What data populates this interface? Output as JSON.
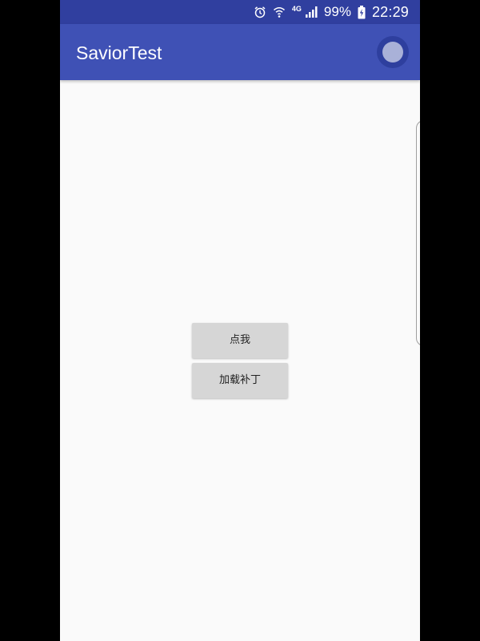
{
  "status_bar": {
    "network_label": "4G",
    "battery_percent": "99%",
    "time": "22:29",
    "icons": [
      "alarm-icon",
      "wifi-icon",
      "signal-icon",
      "battery-charging-icon"
    ],
    "background_color": "#303f9f"
  },
  "app_bar": {
    "title": "SaviorTest",
    "background_color": "#3f51b5",
    "floating_widget": "floating-assistive-ball-icon"
  },
  "buttons": [
    {
      "id": "click-me",
      "label": "点我"
    },
    {
      "id": "load-patch",
      "label": "加载补丁"
    }
  ],
  "colors": {
    "content_background": "#fafafa",
    "button_background": "#d6d6d6",
    "outer_background": "#000000"
  }
}
